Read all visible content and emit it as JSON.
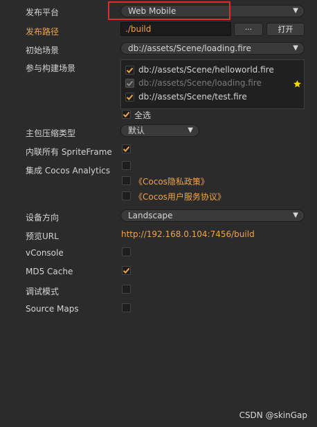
{
  "rows": {
    "platform": {
      "label": "发布平台",
      "value": "Web Mobile"
    },
    "build_path": {
      "label": "发布路径",
      "value": "./build",
      "browse_label": "···",
      "open_label": "打开"
    },
    "start_scene": {
      "label": "初始场景",
      "value": "db://assets/Scene/loading.fire"
    },
    "included_scenes": {
      "label": "参与构建场景",
      "items": [
        {
          "path": "db://assets/Scene/helloworld.fire",
          "checked": true,
          "disabled": false
        },
        {
          "path": "db://assets/Scene/loading.fire",
          "checked": true,
          "disabled": true
        },
        {
          "path": "db://assets/Scene/test.fire",
          "checked": true,
          "disabled": false
        }
      ],
      "select_all_label": "全选"
    },
    "compression": {
      "label": "主包压缩类型",
      "value": "默认"
    },
    "inline_spriteframe": {
      "label": "内联所有 SpriteFrame",
      "checked": true
    },
    "analytics": {
      "label": "集成 Cocos Analytics",
      "checked": false,
      "privacy_link": "《Cocos隐私政策》",
      "service_link": "《Cocos用户服务协议》"
    },
    "orientation": {
      "label": "设备方向",
      "value": "Landscape"
    },
    "preview_url": {
      "label": "预览URL",
      "value": "http://192.168.0.104:7456/build"
    },
    "vconsole": {
      "label": "vConsole",
      "checked": false
    },
    "md5_cache": {
      "label": "MD5 Cache",
      "checked": true
    },
    "debug": {
      "label": "调试模式",
      "checked": false
    },
    "source_maps": {
      "label": "Source Maps",
      "checked": false
    }
  },
  "icons": {
    "dropdown": "triangle-down-icon",
    "check": "checkmark-icon",
    "star": "star-icon"
  },
  "colors": {
    "accent": "#f0a44b",
    "highlight": "#e52a2a",
    "star": "#f5d800"
  },
  "watermark": "CSDN @skinGap"
}
